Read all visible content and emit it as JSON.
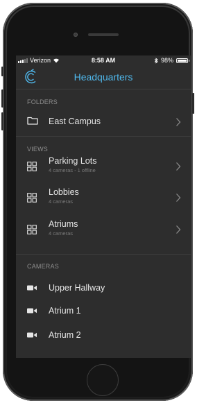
{
  "status_bar": {
    "carrier": "Verizon",
    "time": "8:58 AM",
    "battery": "98%",
    "battery_level": 0.98
  },
  "nav": {
    "title": "Headquarters",
    "logo_icon": "app-logo-icon"
  },
  "folders": {
    "header": "FOLDERS",
    "items": [
      {
        "label": "East Campus",
        "icon": "folder-icon"
      }
    ]
  },
  "views": {
    "header": "VIEWS",
    "items": [
      {
        "label": "Parking Lots",
        "sub": "4 cameras - 1 offline",
        "icon": "grid-icon"
      },
      {
        "label": "Lobbies",
        "sub": "4 cameras",
        "icon": "grid-icon"
      },
      {
        "label": "Atriums",
        "sub": "4 cameras",
        "icon": "grid-icon"
      }
    ]
  },
  "cameras": {
    "header": "CAMERAS",
    "items": [
      {
        "label": "Upper Hallway",
        "icon": "video-camera-icon"
      },
      {
        "label": "Atrium 1",
        "icon": "video-camera-icon"
      },
      {
        "label": "Atrium 2",
        "icon": "video-camera-icon"
      }
    ]
  },
  "colors": {
    "accent": "#4fb8ec",
    "screen_background": "#2d2d2d",
    "text_primary": "#e6e6e6",
    "text_secondary": "#7a7a7a"
  }
}
